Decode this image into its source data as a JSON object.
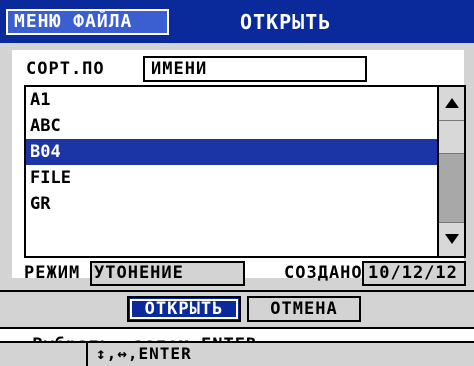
{
  "header": {
    "menu_tab": "МЕНЮ ФАЙЛА",
    "title": "ОТКРЫТЬ"
  },
  "sort": {
    "label": "СОРТ.ПО",
    "value": "ИМЕНИ"
  },
  "files": [
    {
      "name": "A1",
      "selected": false
    },
    {
      "name": "ABC",
      "selected": false
    },
    {
      "name": "B04",
      "selected": true
    },
    {
      "name": "FILE",
      "selected": false
    },
    {
      "name": "GR",
      "selected": false
    }
  ],
  "info": {
    "mode_label": "РЕЖИМ",
    "mode_value": "УТОНЕНИЕ",
    "created_label": "СОЗДАНО",
    "created_value": "10/12/12"
  },
  "buttons": {
    "open": "ОТКРЫТЬ",
    "cancel": "ОТМЕНА"
  },
  "help": {
    "text": "↔ Выбрать, затем ENTER.",
    "keys": "↕,↔,ENTER"
  },
  "colors": {
    "title_bar": "#0a2a9c",
    "selection": "#1b34a6",
    "background": "#d3d3d3"
  }
}
